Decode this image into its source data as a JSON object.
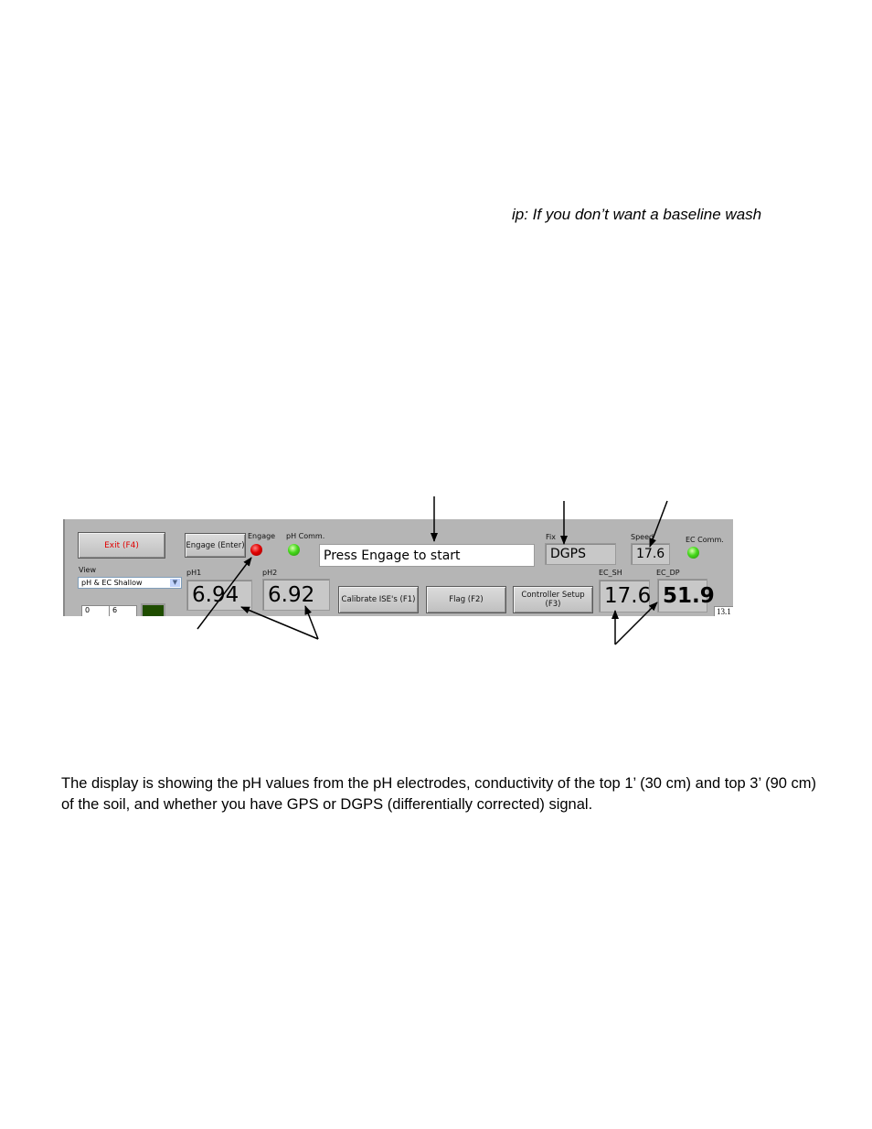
{
  "tip_text": "ip:  If you don’t want a baseline wash",
  "paragraph": "The display is showing the pH values from the pH electrodes, conductivity of the top 1’ (30 cm) and top 3’ (90 cm) of the soil, and whether you have GPS or DGPS (differentially corrected) signal.",
  "panel": {
    "exit_button": "Exit (F4)",
    "exit_color": "#e00000",
    "engage_button": "Engage (Enter)",
    "engage_label": "Engage",
    "engage_led": "red",
    "ph_comm_label": "pH Comm.",
    "ph_comm_led": "green",
    "status_message": "Press Engage to start",
    "fix_label": "Fix",
    "fix_value": "DGPS",
    "speed_label": "Speed",
    "speed_value": "17.6",
    "ec_comm_label": "EC Comm.",
    "ec_comm_led": "green",
    "view_label": "View",
    "view_selected": "pH & EC Shallow",
    "ph1_label": "pH1",
    "ph1_value": "6.94",
    "ph2_label": "pH2",
    "ph2_value": "6.92",
    "calibrate_button": "Calibrate ISE's (F1)",
    "flag_button": "Flag (F2)",
    "controller_button": "Controller Setup (F3)",
    "ec_sh_label": "EC_SH",
    "ec_sh_value": "17.6",
    "ec_dp_label": "EC_DP",
    "ec_dp_value": "51.9",
    "cell_a": "0",
    "cell_b": "6",
    "corner_value": "13.1"
  }
}
